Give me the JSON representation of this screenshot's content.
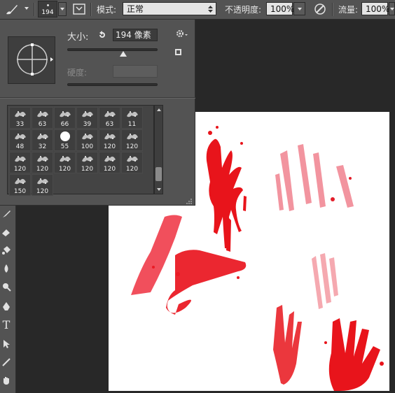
{
  "options_bar": {
    "brush_size": "194",
    "mode_label": "模式:",
    "mode_value": "正常",
    "opacity_label": "不透明度:",
    "opacity_value": "100%",
    "flow_label": "流量:",
    "flow_value": "100%"
  },
  "brush_panel": {
    "size_label": "大小:",
    "size_value": "194 像素",
    "hardness_label": "硬度:",
    "hardness_value": "",
    "size_slider_fraction": 0.62,
    "presets": [
      [
        "33",
        "63",
        "66",
        "39",
        "63",
        "11"
      ],
      [
        "48",
        "32",
        "55",
        "100",
        "120",
        "120"
      ],
      [
        "120",
        "120",
        "120",
        "120",
        "120",
        "120"
      ],
      [
        "150",
        "120"
      ]
    ]
  },
  "colors": {
    "ui_bg": "#535353",
    "canvas_bg": "#282828",
    "document": "#ffffff",
    "blood": "#e8141b"
  },
  "tools": [
    "brush-icon",
    "eraser-icon",
    "paint-bucket-icon",
    "blur-icon",
    "dodge-icon",
    "pen-icon",
    "type-icon",
    "path-selection-icon",
    "line-icon",
    "hand-icon"
  ]
}
